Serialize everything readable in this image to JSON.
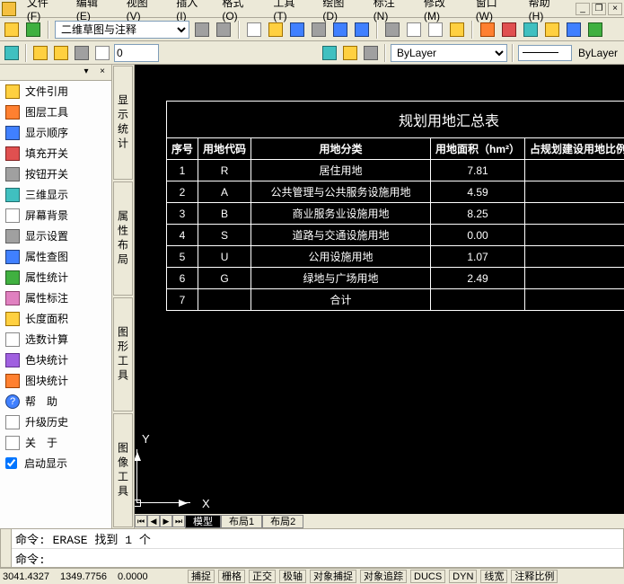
{
  "menu": {
    "items": [
      "文件(F)",
      "编辑(E)",
      "视图(V)",
      "插入(I)",
      "格式(O)",
      "工具(T)",
      "绘图(D)",
      "标注(N)",
      "修改(M)",
      "窗口(W)",
      "帮助(H)"
    ]
  },
  "tb1": {
    "workspace": "二维草图与注释"
  },
  "tb2": {
    "lineweight_input": "0",
    "layer_dropdown": "ByLayer",
    "layer_label2": "ByLayer"
  },
  "sidebar": {
    "items": [
      {
        "label": "文件引用"
      },
      {
        "label": "图层工具"
      },
      {
        "label": "显示顺序"
      },
      {
        "label": "填充开关"
      },
      {
        "label": "按钮开关"
      },
      {
        "label": "三维显示"
      },
      {
        "label": "屏幕背景"
      },
      {
        "label": "显示设置"
      },
      {
        "label": "属性查图"
      },
      {
        "label": "属性统计"
      },
      {
        "label": "属性标注"
      },
      {
        "label": "长度面积"
      },
      {
        "label": "选数计算"
      },
      {
        "label": "色块统计"
      },
      {
        "label": "图块统计"
      },
      {
        "label": "帮　助"
      },
      {
        "label": "升级历史"
      },
      {
        "label": "关　于"
      },
      {
        "label": "启动显示"
      }
    ]
  },
  "midblocks": [
    "显示统计",
    "属性布局",
    "图形工具",
    "图像工具"
  ],
  "cad": {
    "title": "规划用地汇总表",
    "headers": [
      "序号",
      "用地代码",
      "用地分类",
      "用地面积（hm²）",
      "占规划建设用地比例"
    ],
    "rows": [
      {
        "n": "1",
        "code": "R",
        "cat": "居住用地",
        "area": "7.81",
        "pct": ""
      },
      {
        "n": "2",
        "code": "A",
        "cat": "公共管理与公共服务设施用地",
        "area": "4.59",
        "pct": ""
      },
      {
        "n": "3",
        "code": "B",
        "cat": "商业服务业设施用地",
        "area": "8.25",
        "pct": ""
      },
      {
        "n": "4",
        "code": "S",
        "cat": "道路与交通设施用地",
        "area": "0.00",
        "pct": ""
      },
      {
        "n": "5",
        "code": "U",
        "cat": "公用设施用地",
        "area": "1.07",
        "pct": ""
      },
      {
        "n": "6",
        "code": "G",
        "cat": "绿地与广场用地",
        "area": "2.49",
        "pct": ""
      },
      {
        "n": "7",
        "code": "",
        "cat": "合计",
        "area": "",
        "pct": ""
      }
    ],
    "axis_y": "Y",
    "axis_x": "X"
  },
  "tabs": {
    "items": [
      "模型",
      "布局1",
      "布局2"
    ],
    "active": 0
  },
  "cmd": {
    "line1": "命令:  ERASE 找到 1 个",
    "line2": "命令:"
  },
  "status": {
    "coords": [
      "3041.4327",
      "1349.7756",
      "0.0000"
    ],
    "modes": [
      "捕捉",
      "栅格",
      "正交",
      "极轴",
      "对象捕捉",
      "对象追踪",
      "DUCS",
      "DYN",
      "线宽",
      "注释比例"
    ]
  }
}
